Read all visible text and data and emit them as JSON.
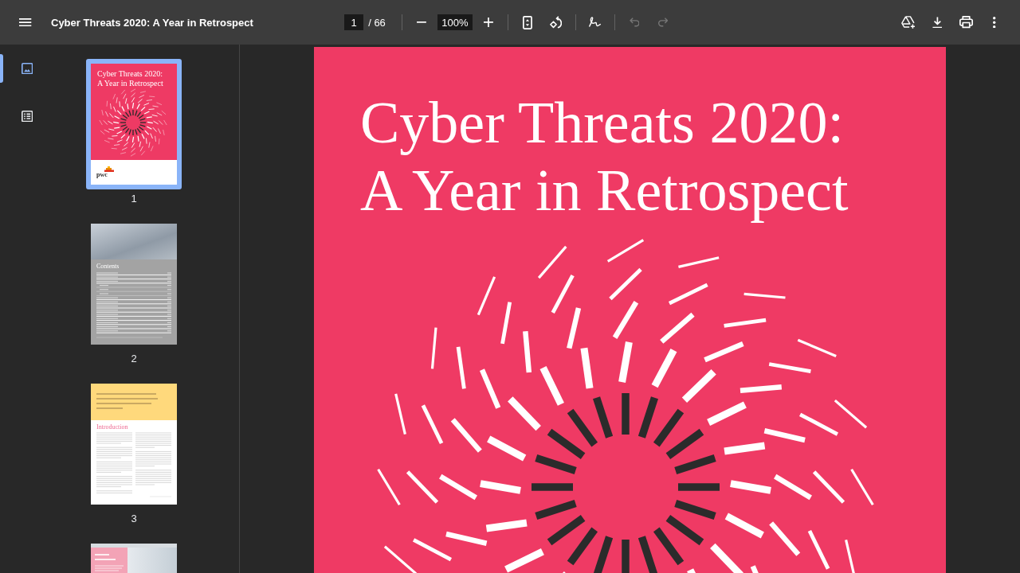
{
  "toolbar": {
    "title": "Cyber Threats 2020: A Year in Retrospect",
    "groups": [
      {
        "items": [
          {
            "kind": "page-field",
            "value": "1"
          },
          {
            "kind": "page-count",
            "text": "/ 66"
          }
        ]
      },
      {
        "items": [
          {
            "kind": "zoom-out",
            "disabled": false
          },
          {
            "kind": "zoom-field",
            "value": "100%"
          },
          {
            "kind": "zoom-in",
            "disabled": false
          }
        ]
      },
      {
        "items": [
          {
            "kind": "fit-page",
            "disabled": false
          },
          {
            "kind": "rotate",
            "disabled": false
          }
        ]
      },
      {
        "items": [
          {
            "kind": "annotate",
            "disabled": false
          }
        ]
      },
      {
        "items": [
          {
            "kind": "undo",
            "disabled": true
          },
          {
            "kind": "redo",
            "disabled": true
          }
        ]
      }
    ],
    "actions": [
      {
        "kind": "save-to-drive"
      },
      {
        "kind": "download"
      },
      {
        "kind": "print"
      },
      {
        "kind": "more"
      }
    ]
  },
  "sidebar": {
    "tabs": [
      {
        "kind": "thumbnails",
        "selected": true
      },
      {
        "kind": "outline",
        "selected": false
      }
    ],
    "thumbnails": [
      {
        "kind": "cover",
        "selected": true,
        "title": "Cyber Threats 2020: A Year in Retrospect",
        "logo": "pwc",
        "page_label": "1"
      },
      {
        "kind": "contents",
        "selected": false,
        "heading": "Contents",
        "page_label": "2"
      },
      {
        "kind": "intro",
        "selected": false,
        "heading": "Introduction",
        "page_label": "3"
      },
      {
        "kind": "photo",
        "selected": false
      }
    ]
  },
  "document": {
    "page": {
      "title": "Cyber Threats 2020: A Year in Retrospect"
    }
  }
}
